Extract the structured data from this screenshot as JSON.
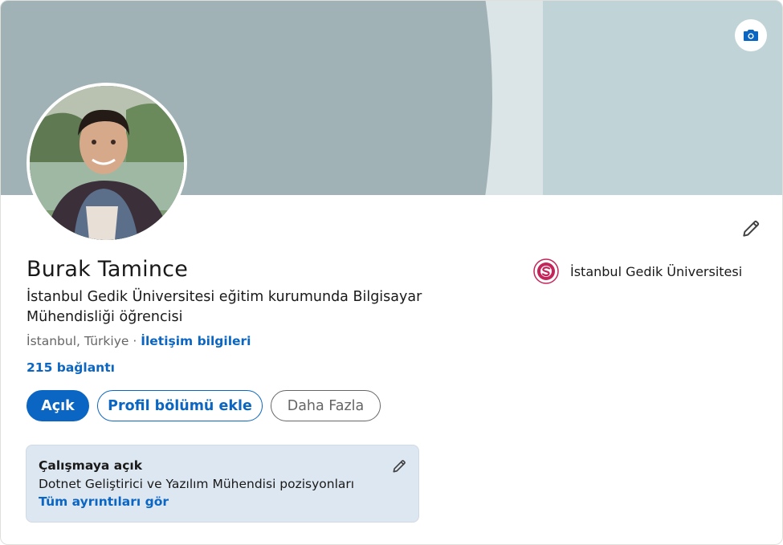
{
  "profile": {
    "name": "Burak Tamince",
    "headline": "İstanbul Gedik Üniversitesi eğitim kurumunda Bilgisayar Mühendisliği öğrencisi",
    "location": "İstanbul, Türkiye",
    "separator": " · ",
    "contact_link": "İletişim bilgileri",
    "connections": "215 bağlantı"
  },
  "actions": {
    "open_label": "Açık",
    "add_section_label": "Profil bölümü ekle",
    "more_label": "Daha Fazla"
  },
  "education": {
    "school_name": "İstanbul Gedik Üniversitesi"
  },
  "open_to_work": {
    "title": "Çalışmaya açık",
    "description": "Dotnet Geliştirici ve Yazılım Mühendisi pozisyonları",
    "link": "Tüm ayrıntıları gör"
  },
  "icons": {
    "camera": "camera-icon",
    "edit": "pencil-icon",
    "school_logo": "school-logo"
  },
  "colors": {
    "accent": "#0a66c2",
    "banner_dark": "#a0b2b5",
    "banner_light": "#c0d3d6",
    "banner_mid": "#dbe5e7",
    "open_box_bg": "#dde7f1",
    "school_brand": "#c4245a"
  }
}
